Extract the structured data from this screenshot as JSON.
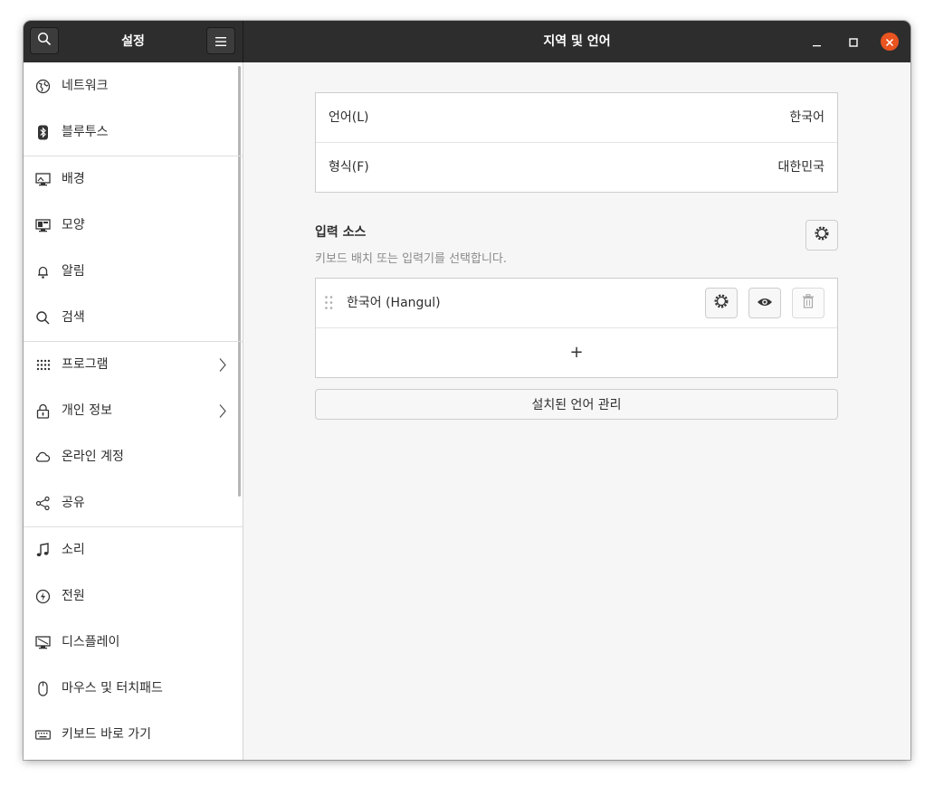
{
  "header": {
    "sidebar_title": "설정",
    "title": "지역 및 언어",
    "icons": {
      "search": "search-icon",
      "menu": "hamburger-menu-icon"
    },
    "controls": [
      "minimize-icon",
      "maximize-icon",
      "close-icon"
    ]
  },
  "sidebar": {
    "items": [
      {
        "label": "네트워크",
        "icon": "globe-network-icon"
      },
      {
        "label": "블루투스",
        "icon": "bluetooth-icon"
      },
      {
        "label": "배경",
        "icon": "monitor-background-icon"
      },
      {
        "label": "모양",
        "icon": "appearance-icon"
      },
      {
        "label": "알림",
        "icon": "bell-icon"
      },
      {
        "label": "검색",
        "icon": "search-icon"
      },
      {
        "label": "프로그램",
        "icon": "apps-grid-icon",
        "chevron": true
      },
      {
        "label": "개인 정보",
        "icon": "lock-icon",
        "chevron": true
      },
      {
        "label": "온라인 계정",
        "icon": "cloud-icon"
      },
      {
        "label": "공유",
        "icon": "share-icon"
      },
      {
        "label": "소리",
        "icon": "music-note-icon"
      },
      {
        "label": "전원",
        "icon": "power-icon"
      },
      {
        "label": "디스플레이",
        "icon": "display-icon"
      },
      {
        "label": "마우스 및 터치패드",
        "icon": "mouse-icon"
      },
      {
        "label": "키보드 바로 가기",
        "icon": "keyboard-icon"
      }
    ]
  },
  "main": {
    "language_row": {
      "label": "언어(L)",
      "value": "한국어"
    },
    "formats_row": {
      "label": "형식(F)",
      "value": "대한민국"
    },
    "input_sources": {
      "title": "입력 소스",
      "description": "키보드 배치 또는 입력기를 선택합니다.",
      "items": [
        {
          "label": "한국어 (Hangul)"
        }
      ],
      "add_label": "+"
    },
    "manage_button": "설치된 언어 관리"
  },
  "colors": {
    "accent": "#e95420",
    "header_bg": "#2d2d2d"
  }
}
